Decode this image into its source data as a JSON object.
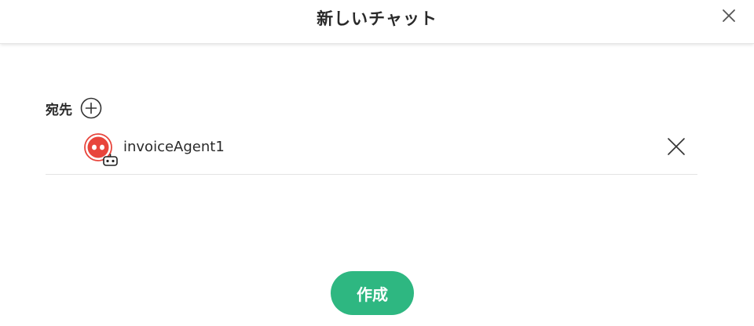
{
  "dialog": {
    "title": "新しいチャット",
    "close_icon": "close-icon"
  },
  "recipients_section": {
    "label": "宛先",
    "add_icon": "plus-circle-icon",
    "items": [
      {
        "name": "invoiceAgent1",
        "avatar_icon": "bot-avatar-icon",
        "avatar_color": "#e8453c",
        "badge_icon": "robot-badge-icon",
        "remove_icon": "close-icon"
      }
    ]
  },
  "actions": {
    "create_label": "作成",
    "create_color": "#2eb781"
  }
}
